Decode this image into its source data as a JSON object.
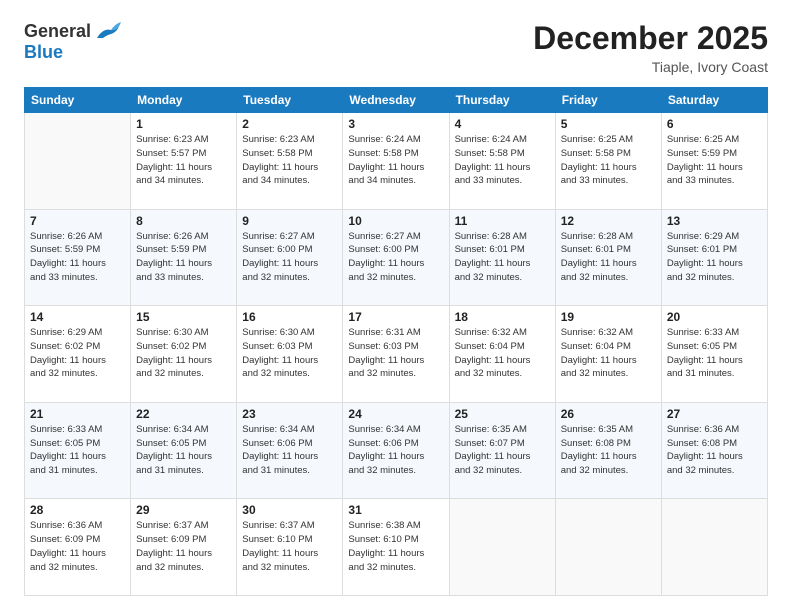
{
  "logo": {
    "general": "General",
    "blue": "Blue"
  },
  "title": "December 2025",
  "location": "Tiaple, Ivory Coast",
  "days_of_week": [
    "Sunday",
    "Monday",
    "Tuesday",
    "Wednesday",
    "Thursday",
    "Friday",
    "Saturday"
  ],
  "weeks": [
    [
      {
        "num": "",
        "info": ""
      },
      {
        "num": "1",
        "info": "Sunrise: 6:23 AM\nSunset: 5:57 PM\nDaylight: 11 hours\nand 34 minutes."
      },
      {
        "num": "2",
        "info": "Sunrise: 6:23 AM\nSunset: 5:58 PM\nDaylight: 11 hours\nand 34 minutes."
      },
      {
        "num": "3",
        "info": "Sunrise: 6:24 AM\nSunset: 5:58 PM\nDaylight: 11 hours\nand 34 minutes."
      },
      {
        "num": "4",
        "info": "Sunrise: 6:24 AM\nSunset: 5:58 PM\nDaylight: 11 hours\nand 33 minutes."
      },
      {
        "num": "5",
        "info": "Sunrise: 6:25 AM\nSunset: 5:58 PM\nDaylight: 11 hours\nand 33 minutes."
      },
      {
        "num": "6",
        "info": "Sunrise: 6:25 AM\nSunset: 5:59 PM\nDaylight: 11 hours\nand 33 minutes."
      }
    ],
    [
      {
        "num": "7",
        "info": "Sunrise: 6:26 AM\nSunset: 5:59 PM\nDaylight: 11 hours\nand 33 minutes."
      },
      {
        "num": "8",
        "info": "Sunrise: 6:26 AM\nSunset: 5:59 PM\nDaylight: 11 hours\nand 33 minutes."
      },
      {
        "num": "9",
        "info": "Sunrise: 6:27 AM\nSunset: 6:00 PM\nDaylight: 11 hours\nand 32 minutes."
      },
      {
        "num": "10",
        "info": "Sunrise: 6:27 AM\nSunset: 6:00 PM\nDaylight: 11 hours\nand 32 minutes."
      },
      {
        "num": "11",
        "info": "Sunrise: 6:28 AM\nSunset: 6:01 PM\nDaylight: 11 hours\nand 32 minutes."
      },
      {
        "num": "12",
        "info": "Sunrise: 6:28 AM\nSunset: 6:01 PM\nDaylight: 11 hours\nand 32 minutes."
      },
      {
        "num": "13",
        "info": "Sunrise: 6:29 AM\nSunset: 6:01 PM\nDaylight: 11 hours\nand 32 minutes."
      }
    ],
    [
      {
        "num": "14",
        "info": "Sunrise: 6:29 AM\nSunset: 6:02 PM\nDaylight: 11 hours\nand 32 minutes."
      },
      {
        "num": "15",
        "info": "Sunrise: 6:30 AM\nSunset: 6:02 PM\nDaylight: 11 hours\nand 32 minutes."
      },
      {
        "num": "16",
        "info": "Sunrise: 6:30 AM\nSunset: 6:03 PM\nDaylight: 11 hours\nand 32 minutes."
      },
      {
        "num": "17",
        "info": "Sunrise: 6:31 AM\nSunset: 6:03 PM\nDaylight: 11 hours\nand 32 minutes."
      },
      {
        "num": "18",
        "info": "Sunrise: 6:32 AM\nSunset: 6:04 PM\nDaylight: 11 hours\nand 32 minutes."
      },
      {
        "num": "19",
        "info": "Sunrise: 6:32 AM\nSunset: 6:04 PM\nDaylight: 11 hours\nand 32 minutes."
      },
      {
        "num": "20",
        "info": "Sunrise: 6:33 AM\nSunset: 6:05 PM\nDaylight: 11 hours\nand 31 minutes."
      }
    ],
    [
      {
        "num": "21",
        "info": "Sunrise: 6:33 AM\nSunset: 6:05 PM\nDaylight: 11 hours\nand 31 minutes."
      },
      {
        "num": "22",
        "info": "Sunrise: 6:34 AM\nSunset: 6:05 PM\nDaylight: 11 hours\nand 31 minutes."
      },
      {
        "num": "23",
        "info": "Sunrise: 6:34 AM\nSunset: 6:06 PM\nDaylight: 11 hours\nand 31 minutes."
      },
      {
        "num": "24",
        "info": "Sunrise: 6:34 AM\nSunset: 6:06 PM\nDaylight: 11 hours\nand 32 minutes."
      },
      {
        "num": "25",
        "info": "Sunrise: 6:35 AM\nSunset: 6:07 PM\nDaylight: 11 hours\nand 32 minutes."
      },
      {
        "num": "26",
        "info": "Sunrise: 6:35 AM\nSunset: 6:08 PM\nDaylight: 11 hours\nand 32 minutes."
      },
      {
        "num": "27",
        "info": "Sunrise: 6:36 AM\nSunset: 6:08 PM\nDaylight: 11 hours\nand 32 minutes."
      }
    ],
    [
      {
        "num": "28",
        "info": "Sunrise: 6:36 AM\nSunset: 6:09 PM\nDaylight: 11 hours\nand 32 minutes."
      },
      {
        "num": "29",
        "info": "Sunrise: 6:37 AM\nSunset: 6:09 PM\nDaylight: 11 hours\nand 32 minutes."
      },
      {
        "num": "30",
        "info": "Sunrise: 6:37 AM\nSunset: 6:10 PM\nDaylight: 11 hours\nand 32 minutes."
      },
      {
        "num": "31",
        "info": "Sunrise: 6:38 AM\nSunset: 6:10 PM\nDaylight: 11 hours\nand 32 minutes."
      },
      {
        "num": "",
        "info": ""
      },
      {
        "num": "",
        "info": ""
      },
      {
        "num": "",
        "info": ""
      }
    ]
  ]
}
